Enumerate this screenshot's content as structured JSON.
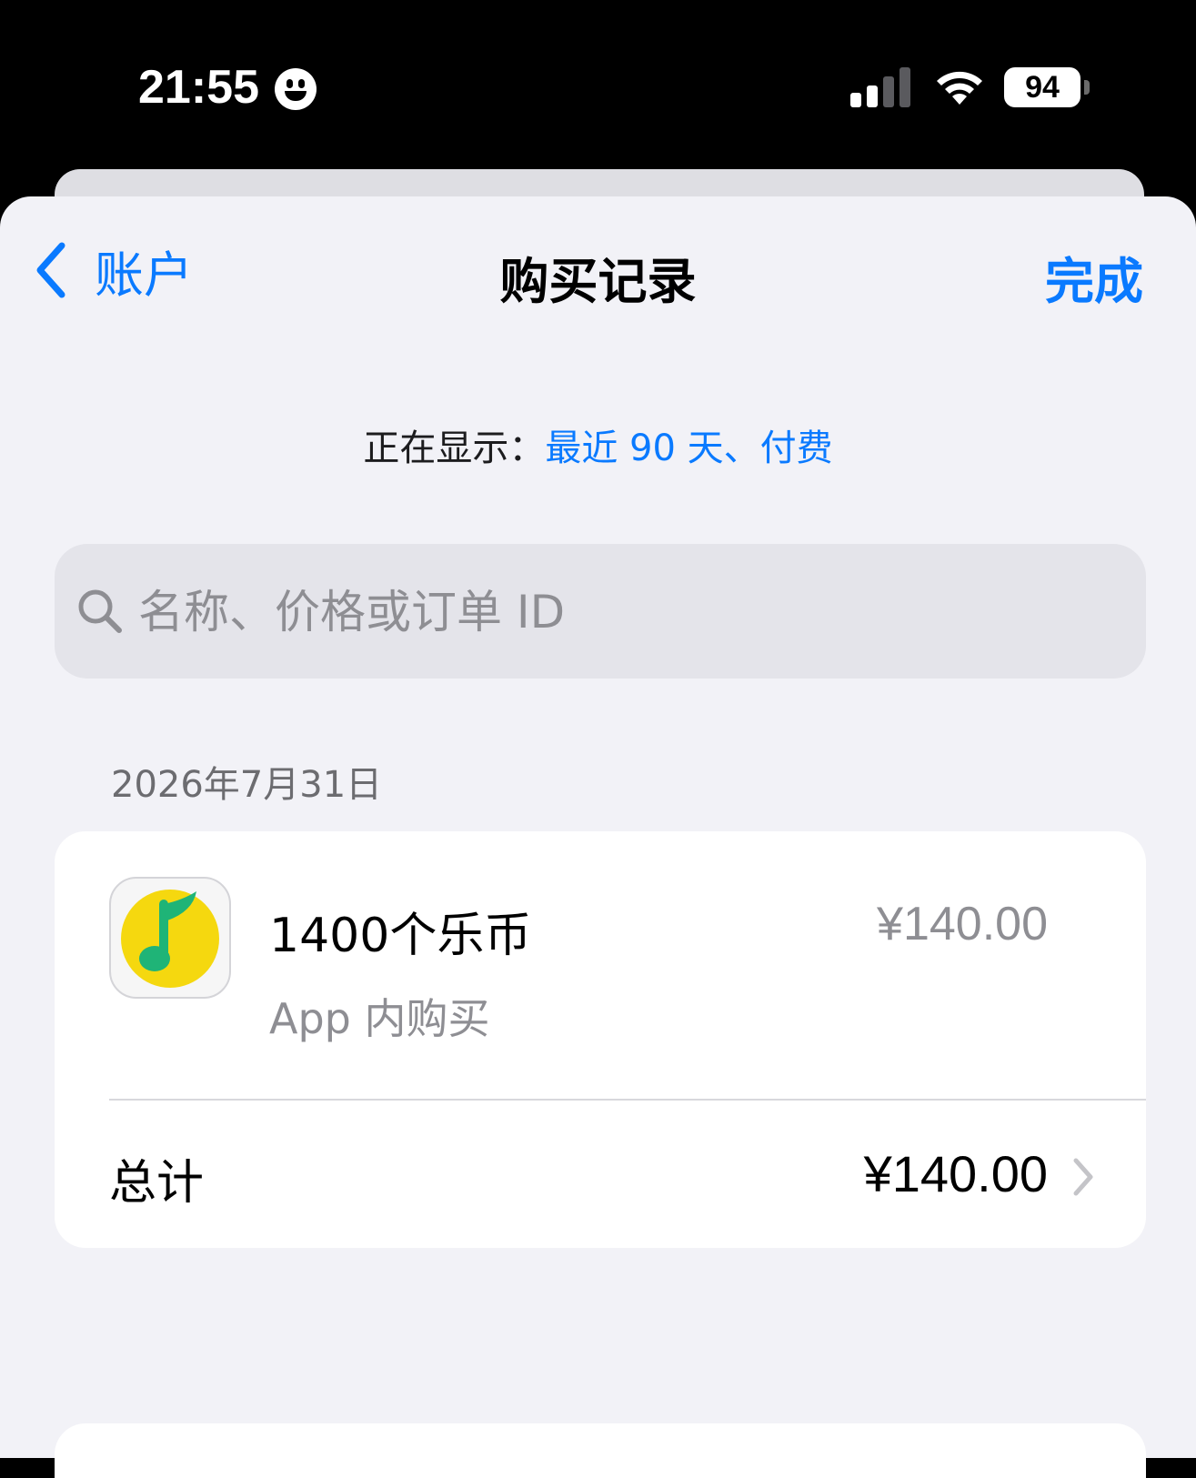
{
  "status_bar": {
    "time": "21:55",
    "battery_level": "94"
  },
  "nav": {
    "back_label": "账户",
    "title": "购买记录",
    "done_label": "完成"
  },
  "filter": {
    "prefix": "正在显示：",
    "value": "最近 90 天、付费"
  },
  "search": {
    "placeholder": "名称、价格或订单 ID"
  },
  "purchases": [
    {
      "date": "2026年7月31日",
      "item": {
        "name": "1400个乐币",
        "price": "¥140.00",
        "type": "App 内购买",
        "icon": "music-note-app-icon"
      },
      "total_label": "总计",
      "total_price": "¥140.00"
    }
  ],
  "colors": {
    "accent": "#0a7aff",
    "background": "#f2f2f7",
    "card": "#ffffff",
    "secondary_text": "#8e8e93"
  }
}
